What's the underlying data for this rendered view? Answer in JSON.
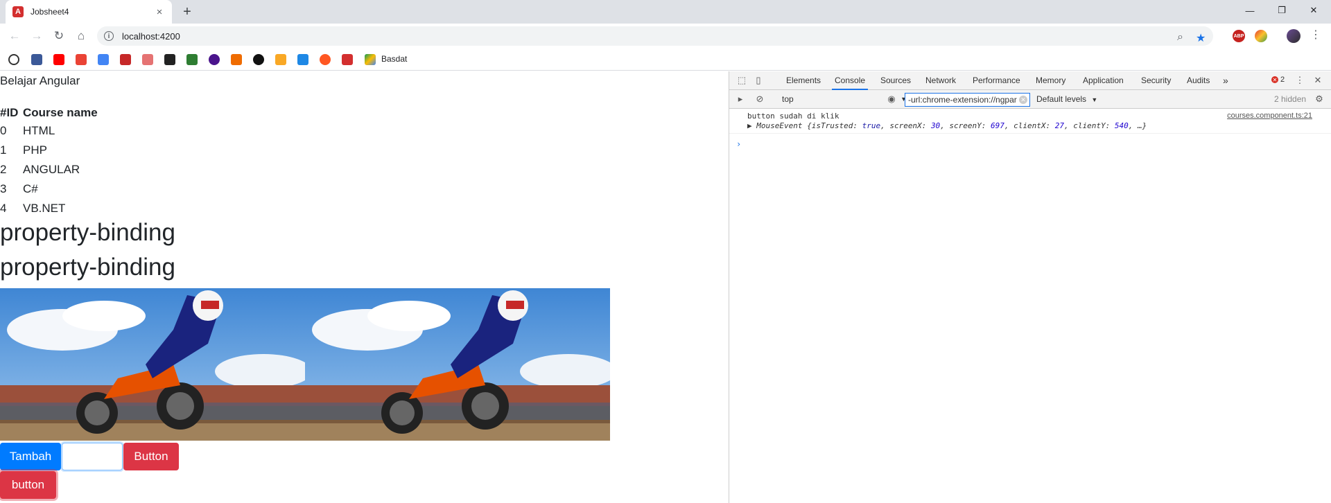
{
  "browser": {
    "tab_title": "Jobsheet4",
    "tab_favicon_letter": "A",
    "tab_close": "×",
    "new_tab": "+",
    "url": "localhost:4200",
    "window_controls": {
      "minimize": "—",
      "restore": "❐",
      "close": "✕"
    },
    "bookmark_label": "Basdat",
    "abp_label": "ABP"
  },
  "page": {
    "title": "Belajar Angular",
    "table": {
      "headers": [
        "#ID",
        "Course name"
      ],
      "rows": [
        {
          "id": "0",
          "name": "HTML"
        },
        {
          "id": "1",
          "name": "PHP"
        },
        {
          "id": "2",
          "name": "ANGULAR"
        },
        {
          "id": "3",
          "name": "C#"
        },
        {
          "id": "4",
          "name": "VB.NET"
        }
      ]
    },
    "heading1": "property-binding",
    "heading2": "property-binding",
    "buttons": {
      "tambah": "Tambah",
      "button": "Button",
      "button_lower": "button"
    },
    "input_value": ""
  },
  "devtools": {
    "tabs": [
      "Elements",
      "Console",
      "Sources",
      "Network",
      "Performance",
      "Memory",
      "Application",
      "Security",
      "Audits"
    ],
    "active_tab": "Console",
    "more_tabs": "»",
    "error_count": "2",
    "context": "top",
    "filter_value": "-url:chrome-extension://ngpar",
    "levels": "Default levels",
    "hidden": "2 hidden",
    "log": {
      "message": "button sudah di klik",
      "source": "courses.component.ts:21",
      "object_prefix": "▶ MouseEvent {isTrusted: ",
      "isTrusted": "true",
      "screenX_label": ", screenX: ",
      "screenX": "30",
      "screenY_label": ", screenY: ",
      "screenY": "697",
      "clientX_label": ", clientX: ",
      "clientX": "27",
      "clientY_label": ", clientY: ",
      "clientY": "540",
      "object_suffix": ", …}"
    },
    "prompt": "›"
  },
  "colors": {
    "primary": "#007bff",
    "danger": "#dc3545",
    "devtools_accent": "#1a73e8"
  }
}
